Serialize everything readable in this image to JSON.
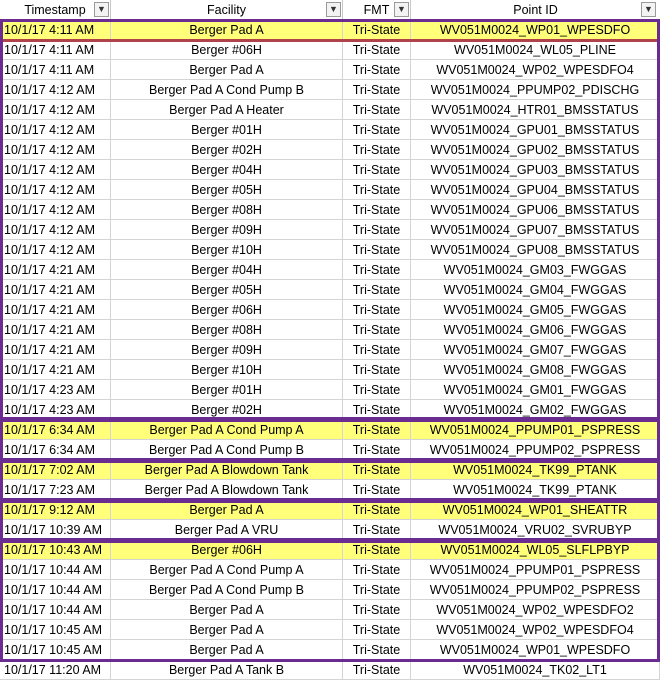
{
  "header": {
    "columns": [
      "Timestamp",
      "Facility",
      "FMT",
      "Point ID"
    ]
  },
  "rows": [
    {
      "ts": "10/1/17 4:11 AM",
      "facility": "Berger Pad A",
      "fmt": "Tri-State",
      "pid": "WV051M0024_WP01_WPESDFO",
      "hl": true
    },
    {
      "ts": "10/1/17 4:11 AM",
      "facility": "Berger #06H",
      "fmt": "Tri-State",
      "pid": "WV051M0024_WL05_PLINE",
      "hl": false
    },
    {
      "ts": "10/1/17 4:11 AM",
      "facility": "Berger Pad A",
      "fmt": "Tri-State",
      "pid": "WV051M0024_WP02_WPESDFO4",
      "hl": false
    },
    {
      "ts": "10/1/17 4:12 AM",
      "facility": "Berger Pad A Cond Pump B",
      "fmt": "Tri-State",
      "pid": "WV051M0024_PPUMP02_PDISCHG",
      "hl": false
    },
    {
      "ts": "10/1/17 4:12 AM",
      "facility": "Berger Pad A Heater",
      "fmt": "Tri-State",
      "pid": "WV051M0024_HTR01_BMSSTATUS",
      "hl": false
    },
    {
      "ts": "10/1/17 4:12 AM",
      "facility": "Berger #01H",
      "fmt": "Tri-State",
      "pid": "WV051M0024_GPU01_BMSSTATUS",
      "hl": false
    },
    {
      "ts": "10/1/17 4:12 AM",
      "facility": "Berger #02H",
      "fmt": "Tri-State",
      "pid": "WV051M0024_GPU02_BMSSTATUS",
      "hl": false
    },
    {
      "ts": "10/1/17 4:12 AM",
      "facility": "Berger #04H",
      "fmt": "Tri-State",
      "pid": "WV051M0024_GPU03_BMSSTATUS",
      "hl": false
    },
    {
      "ts": "10/1/17 4:12 AM",
      "facility": "Berger #05H",
      "fmt": "Tri-State",
      "pid": "WV051M0024_GPU04_BMSSTATUS",
      "hl": false
    },
    {
      "ts": "10/1/17 4:12 AM",
      "facility": "Berger #08H",
      "fmt": "Tri-State",
      "pid": "WV051M0024_GPU06_BMSSTATUS",
      "hl": false
    },
    {
      "ts": "10/1/17 4:12 AM",
      "facility": "Berger #09H",
      "fmt": "Tri-State",
      "pid": "WV051M0024_GPU07_BMSSTATUS",
      "hl": false
    },
    {
      "ts": "10/1/17 4:12 AM",
      "facility": "Berger #10H",
      "fmt": "Tri-State",
      "pid": "WV051M0024_GPU08_BMSSTATUS",
      "hl": false
    },
    {
      "ts": "10/1/17 4:21 AM",
      "facility": "Berger #04H",
      "fmt": "Tri-State",
      "pid": "WV051M0024_GM03_FWGGAS",
      "hl": false
    },
    {
      "ts": "10/1/17 4:21 AM",
      "facility": "Berger #05H",
      "fmt": "Tri-State",
      "pid": "WV051M0024_GM04_FWGGAS",
      "hl": false
    },
    {
      "ts": "10/1/17 4:21 AM",
      "facility": "Berger #06H",
      "fmt": "Tri-State",
      "pid": "WV051M0024_GM05_FWGGAS",
      "hl": false
    },
    {
      "ts": "10/1/17 4:21 AM",
      "facility": "Berger #08H",
      "fmt": "Tri-State",
      "pid": "WV051M0024_GM06_FWGGAS",
      "hl": false
    },
    {
      "ts": "10/1/17 4:21 AM",
      "facility": "Berger #09H",
      "fmt": "Tri-State",
      "pid": "WV051M0024_GM07_FWGGAS",
      "hl": false
    },
    {
      "ts": "10/1/17 4:21 AM",
      "facility": "Berger #10H",
      "fmt": "Tri-State",
      "pid": "WV051M0024_GM08_FWGGAS",
      "hl": false
    },
    {
      "ts": "10/1/17 4:23 AM",
      "facility": "Berger #01H",
      "fmt": "Tri-State",
      "pid": "WV051M0024_GM01_FWGGAS",
      "hl": false
    },
    {
      "ts": "10/1/17 4:23 AM",
      "facility": "Berger #02H",
      "fmt": "Tri-State",
      "pid": "WV051M0024_GM02_FWGGAS",
      "hl": false
    },
    {
      "ts": "10/1/17 6:34 AM",
      "facility": "Berger Pad A Cond Pump A",
      "fmt": "Tri-State",
      "pid": "WV051M0024_PPUMP01_PSPRESS",
      "hl": true
    },
    {
      "ts": "10/1/17 6:34 AM",
      "facility": "Berger Pad A Cond Pump B",
      "fmt": "Tri-State",
      "pid": "WV051M0024_PPUMP02_PSPRESS",
      "hl": false
    },
    {
      "ts": "10/1/17 7:02 AM",
      "facility": "Berger Pad A Blowdown Tank",
      "fmt": "Tri-State",
      "pid": "WV051M0024_TK99_PTANK",
      "hl": true
    },
    {
      "ts": "10/1/17 7:23 AM",
      "facility": "Berger Pad A Blowdown Tank",
      "fmt": "Tri-State",
      "pid": "WV051M0024_TK99_PTANK",
      "hl": false
    },
    {
      "ts": "10/1/17 9:12 AM",
      "facility": "Berger Pad A",
      "fmt": "Tri-State",
      "pid": "WV051M0024_WP01_SHEATTR",
      "hl": true
    },
    {
      "ts": "10/1/17 10:39 AM",
      "facility": "Berger Pad A VRU",
      "fmt": "Tri-State",
      "pid": "WV051M0024_VRU02_SVRUBYP",
      "hl": false
    },
    {
      "ts": "10/1/17 10:43 AM",
      "facility": "Berger #06H",
      "fmt": "Tri-State",
      "pid": "WV051M0024_WL05_SLFLPBYP",
      "hl": true
    },
    {
      "ts": "10/1/17 10:44 AM",
      "facility": "Berger Pad A Cond Pump A",
      "fmt": "Tri-State",
      "pid": "WV051M0024_PPUMP01_PSPRESS",
      "hl": false
    },
    {
      "ts": "10/1/17 10:44 AM",
      "facility": "Berger Pad A Cond Pump B",
      "fmt": "Tri-State",
      "pid": "WV051M0024_PPUMP02_PSPRESS",
      "hl": false
    },
    {
      "ts": "10/1/17 10:44 AM",
      "facility": "Berger Pad A",
      "fmt": "Tri-State",
      "pid": "WV051M0024_WP02_WPESDFO2",
      "hl": false
    },
    {
      "ts": "10/1/17 10:45 AM",
      "facility": "Berger Pad A",
      "fmt": "Tri-State",
      "pid": "WV051M0024_WP02_WPESDFO4",
      "hl": false
    },
    {
      "ts": "10/1/17 10:45 AM",
      "facility": "Berger Pad A",
      "fmt": "Tri-State",
      "pid": "WV051M0024_WP01_WPESDFO",
      "hl": false
    },
    {
      "ts": "10/1/17 11:20 AM",
      "facility": "Berger Pad A Tank B",
      "fmt": "Tri-State",
      "pid": "WV051M0024_TK02_LT1",
      "hl": false
    }
  ],
  "colors": {
    "highlight": "#ffff7a",
    "group_border": "#6a2c91",
    "first_row_border": "#b0434a"
  }
}
